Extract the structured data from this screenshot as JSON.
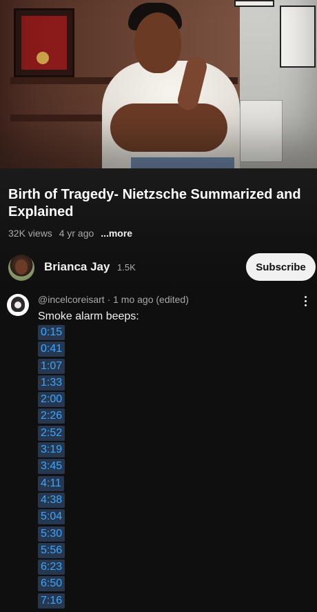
{
  "video": {
    "title": "Birth of Tragedy- Nietzsche Summarized and Explained",
    "views": "32K views",
    "age": "4 yr ago",
    "more": "...more"
  },
  "channel": {
    "name": "Brianca Jay",
    "subscribers": "1.5K",
    "subscribe_label": "Subscribe"
  },
  "comment": {
    "author_line": "@incelcoreisart · 1 mo ago (edited)",
    "text": "Smoke alarm beeps:",
    "timestamps": [
      "0:15",
      "0:41",
      "1:07",
      "1:33",
      "2:00",
      "2:26",
      "2:52",
      "3:19",
      "3:45",
      "4:11",
      "4:38",
      "5:04",
      "5:30",
      "5:56",
      "6:23",
      "6:50",
      "7:16"
    ]
  },
  "colors": {
    "background": "#0f0f0f",
    "link": "#3ea6ff",
    "link_bg": "#263850",
    "subscribe_bg": "#f1f1f1",
    "muted_text": "#aaaaaa"
  }
}
